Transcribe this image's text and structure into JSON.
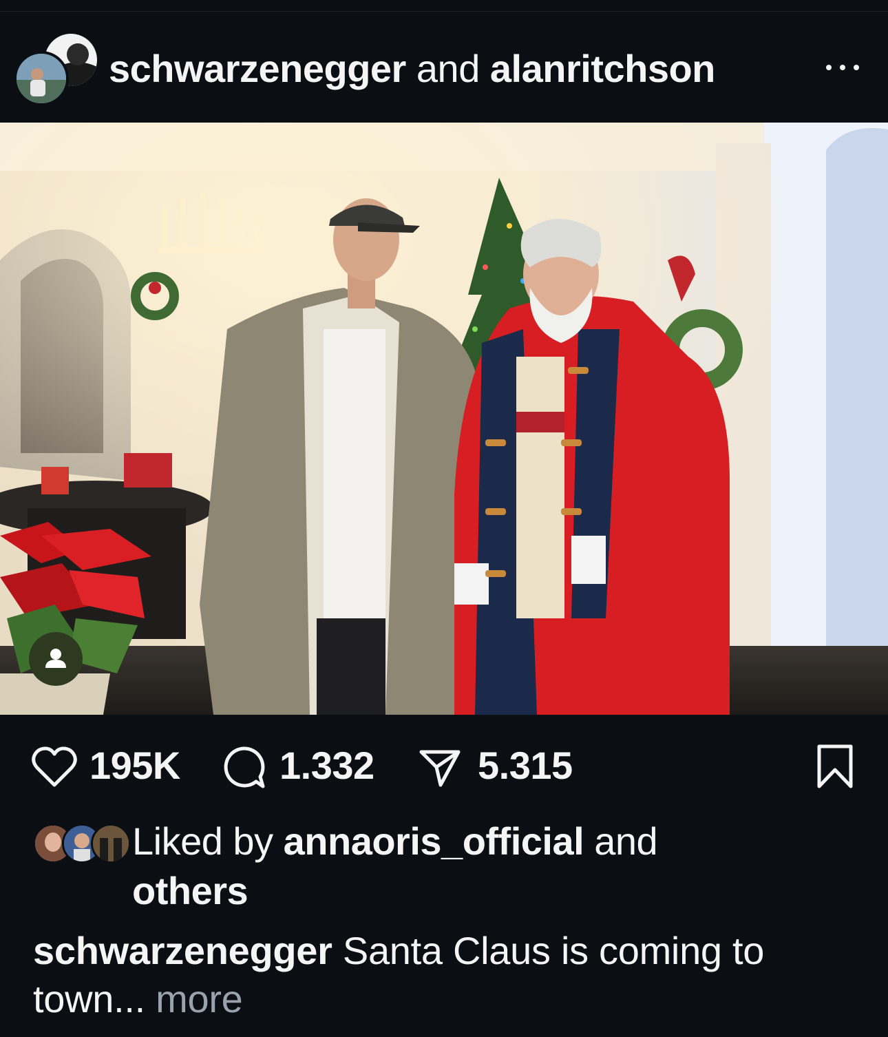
{
  "header": {
    "author": "schwarzenegger",
    "connector": "and",
    "collaborator": "alanritchson",
    "more_icon": "ellipsis-icon"
  },
  "photo": {
    "tag_icon": "person-tag-icon"
  },
  "actions": {
    "likes": "195K",
    "comments": "1.332",
    "shares": "5.315",
    "icons": [
      "heart-icon",
      "comment-icon",
      "send-icon",
      "bookmark-icon"
    ]
  },
  "liked_by": {
    "prefix": "Liked by",
    "user": "annaoris_official",
    "suffix": "and",
    "others": "others"
  },
  "caption": {
    "user": "schwarzenegger",
    "text": "Santa Claus is coming to town...",
    "more": "more"
  },
  "colors": {
    "background": "#0b0f14",
    "text": "#f5f5f5",
    "muted": "#9aa3ad"
  }
}
